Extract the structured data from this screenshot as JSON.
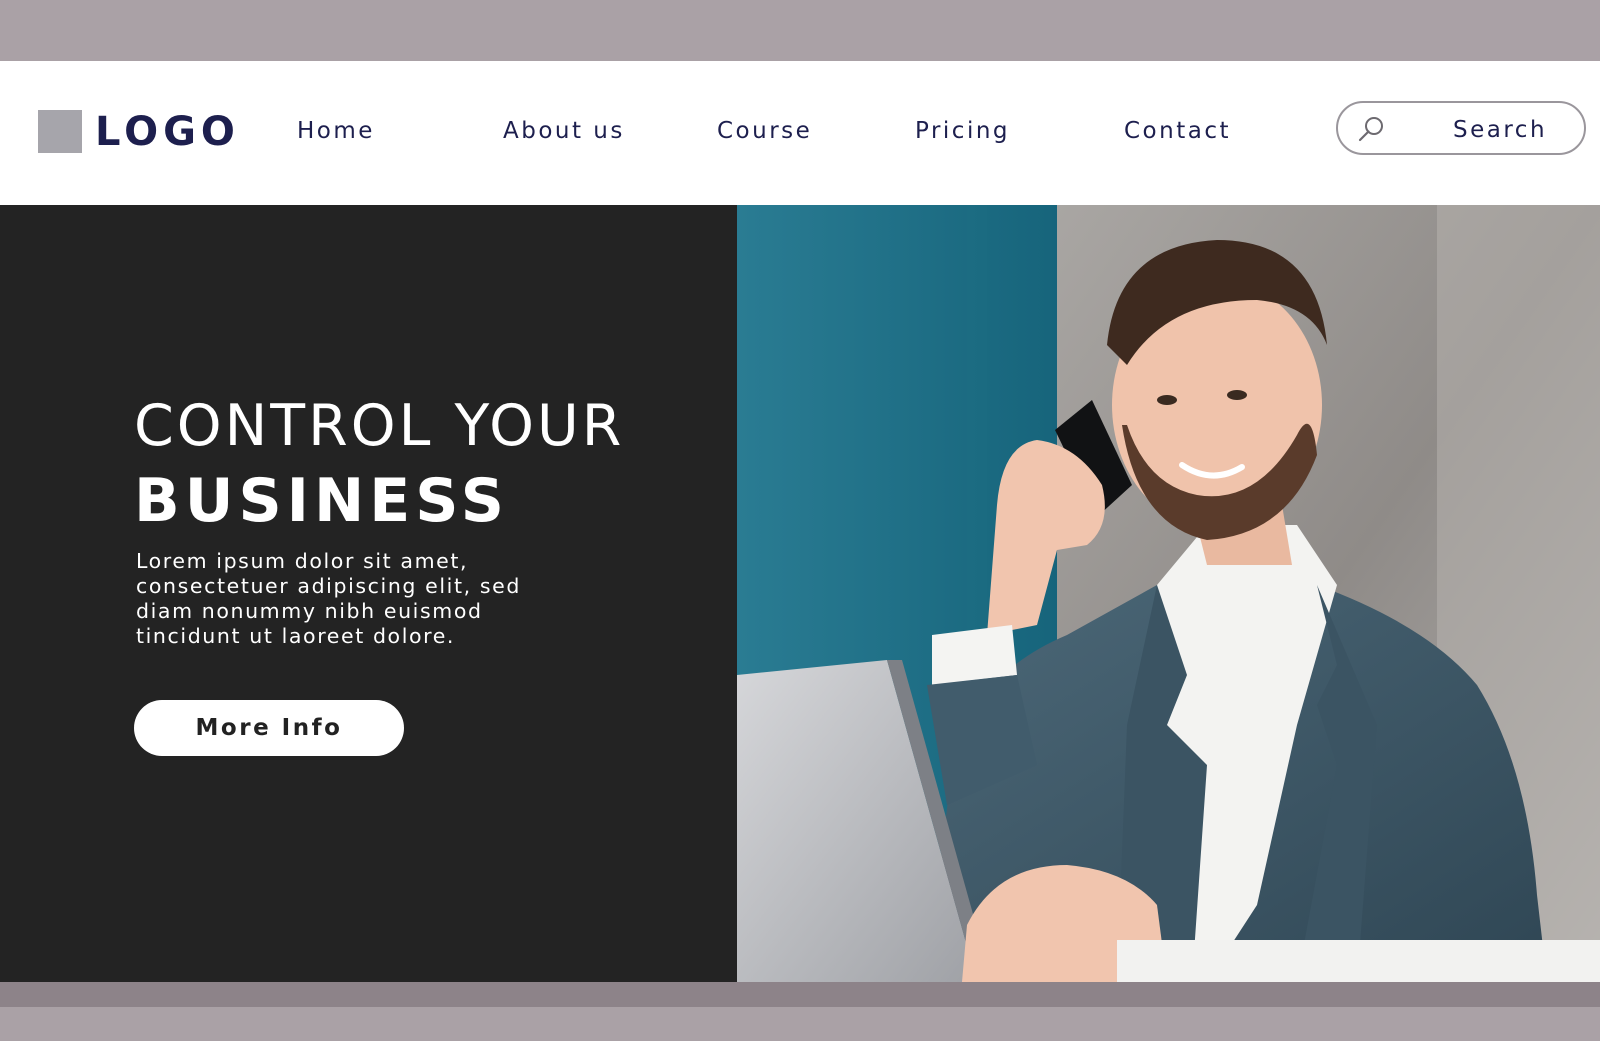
{
  "logo": {
    "text": "LOGO"
  },
  "nav": {
    "home": "Home",
    "about": "About us",
    "course": "Course",
    "pricing": "Pricing",
    "contact": "Contact"
  },
  "search": {
    "label": "Search",
    "icon": "search-icon"
  },
  "hero": {
    "headline_line1": "CONTROL YOUR",
    "headline_line2": "BUSINESS",
    "body_lines": [
      "Lorem ipsum dolor sit amet,",
      "consectetuer adipiscing elit, sed",
      "diam nonummy nibh euismod",
      "tincidunt ut laoreet dolore."
    ],
    "cta": "More Info"
  },
  "colors": {
    "band": "#aaa1a6",
    "navy": "#1d1f4e",
    "hero_dark": "#232323",
    "teal_wall": "#1f7086"
  }
}
